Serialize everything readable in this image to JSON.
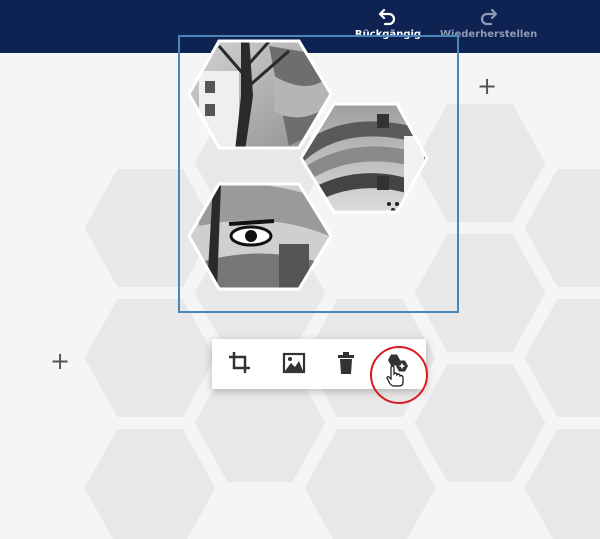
{
  "toolbar_top": {
    "undo_label": "Rückgängig",
    "redo_label": "Wiederherstellen",
    "undo_icon": "undo-arrow-icon",
    "redo_icon": "redo-arrow-icon"
  },
  "canvas": {
    "add_row_icon": "plus-icon",
    "add_column_icon": "plus-icon",
    "add_symbol": "+"
  },
  "collage": {
    "tiles": [
      "street-art-photo-tile-top-left",
      "street-art-photo-tile-right",
      "street-art-photo-tile-bottom-left"
    ]
  },
  "photo_toolbar": {
    "tools": [
      "crop-icon",
      "image-icon",
      "trash-icon",
      "add-hexagon-icon"
    ],
    "highlighted_tool": "add-hexagon-icon"
  },
  "colors": {
    "header": "#0f2352",
    "selection_border": "#4a86b8",
    "highlight_circle": "#d9191e",
    "hex_background": "#e6e6e6"
  }
}
